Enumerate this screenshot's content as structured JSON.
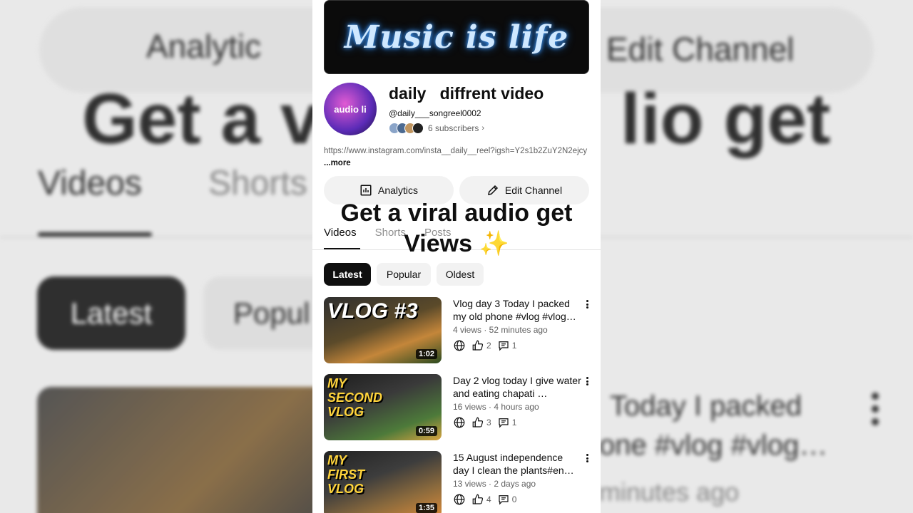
{
  "banner": {
    "text": "Music is life"
  },
  "channel": {
    "avatar_text": "audio li",
    "name": "daily   diffrent video",
    "handle": "@daily___songreel0002",
    "subscribers": "6 subscribers",
    "description": "https://www.instagram.com/insta__daily__reel?igsh=Y2s1b2ZuY2N2ejcy",
    "more_label": "...more"
  },
  "buttons": {
    "analytics": "Analytics",
    "edit_channel": "Edit Channel"
  },
  "overlay": {
    "line1": "Get a viral audio get",
    "line2": "Views",
    "emoji": "✨"
  },
  "tabs": [
    {
      "label": "Videos"
    },
    {
      "label": "Shorts"
    },
    {
      "label": "Posts"
    }
  ],
  "chips": {
    "latest": "Latest",
    "popular": "Popular",
    "oldest": "Oldest"
  },
  "videos": [
    {
      "thumb_text": "VLOG #3",
      "duration": "1:02",
      "title": "Vlog day 3 Today I packed my old phone #vlog #vlog…",
      "meta": "4 views · 52 minutes ago",
      "likes": "2",
      "comments": "1"
    },
    {
      "thumb_text": "MY SECOND VLOG",
      "duration": "0:59",
      "title": "Day 2 vlog today I give water and eating chapati …",
      "meta": "16 views · 4 hours ago",
      "likes": "3",
      "comments": "1"
    },
    {
      "thumb_text": "MY FIRST VLOG",
      "duration": "1:35",
      "title": "15 August independence day I clean the plants#en…",
      "meta": "13 views · 2 days ago",
      "likes": "4",
      "comments": "0"
    }
  ],
  "background": {
    "analytics_label": "Analytic",
    "edit_label": "Edit Channel",
    "headline_left": "Get a v",
    "headline_right": "lio get",
    "videos_label": "Videos",
    "shorts_label": "Shorts",
    "latest_label": "Latest",
    "popular_label": "Popul",
    "title_line1": "Today I packed",
    "title_line2": "one #vlog #vlog…",
    "meta_line": "minutes ago"
  }
}
